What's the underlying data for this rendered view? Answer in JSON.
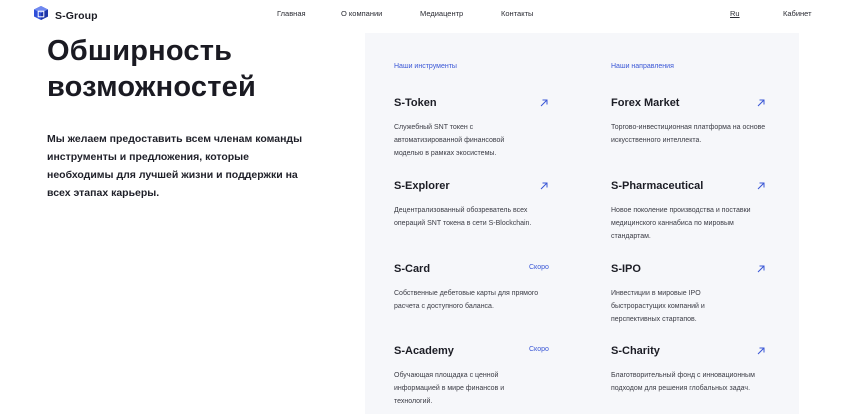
{
  "header": {
    "brand": "S-Group",
    "nav": [
      "Главная",
      "О компании",
      "Медиацентр",
      "Контакты"
    ],
    "lang": "Ru",
    "cabinet": "Кабинет"
  },
  "hero": {
    "title_line1": "Обширность",
    "title_line2": "возможностей",
    "text": "Мы желаем предоставить всем членам команды инструменты и предложения, которые необходимы для лучшей жизни и поддержки на всех этапах карьеры."
  },
  "colors": {
    "accent": "#3a57d6",
    "panel_bg": "#f6f7fa"
  },
  "tools": {
    "label": "Наши инструменты",
    "items": [
      {
        "title": "S-Token",
        "desc": "Служебный SNT токен с автоматизированной финансовой моделью в рамках экосистемы.",
        "icon": "arrow-up-right-icon"
      },
      {
        "title": "S-Explorer",
        "desc": "Децентрализованный обозреватель всех операций SNT токена в сети S-Blockchain.",
        "icon": "arrow-up-right-icon"
      },
      {
        "title": "S-Card",
        "desc": "Собственные дебетовые карты для прямого расчета с доступного баланса.",
        "badge": "Скоро"
      },
      {
        "title": "S-Academy",
        "desc": "Обучающая площадка с ценной информацией в мире финансов и технологий.",
        "badge": "Скоро"
      }
    ]
  },
  "directions": {
    "label": "Наши направления",
    "items": [
      {
        "title": "Forex Market",
        "desc": "Торгово-инвестиционная платформа на основе искусственного интеллекта.",
        "icon": "arrow-up-right-icon"
      },
      {
        "title": "S-Pharmaceutical",
        "desc": "Новое поколение производства и поставки медицинского каннабиса по мировым стандартам.",
        "icon": "arrow-up-right-icon"
      },
      {
        "title": "S-IPO",
        "desc": "Инвестиции в мировые IPO быстрорастущих компаний и перспективных стартапов.",
        "icon": "arrow-up-right-icon"
      },
      {
        "title": "S-Charity",
        "desc": "Благотворительный фонд с инновационным подходом для решения глобальных задач.",
        "icon": "arrow-up-right-icon"
      }
    ]
  }
}
